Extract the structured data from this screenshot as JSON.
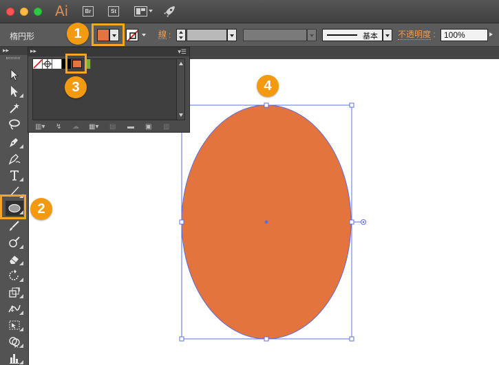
{
  "app": {
    "logo": "Ai",
    "bridge_label": "Br",
    "stock_label": "St",
    "icons": [
      "close-light",
      "minimize-light",
      "maximize-light",
      "layout-icon",
      "rocket-icon"
    ]
  },
  "control_bar": {
    "tool_name": "楕円形",
    "fill_color": "#e4743e",
    "stroke_label": "線",
    "stroke_colon": ":",
    "brush_label": "基本",
    "opacity_label": "不透明度",
    "opacity_colon": ":",
    "opacity_value": "100%"
  },
  "swatches_panel": {
    "panel_arrows": "▸▸",
    "menu_glyph": "▾☰",
    "swatches": [
      "none",
      "registration",
      "white",
      "black",
      "orange",
      "green"
    ],
    "selected_swatch": "orange"
  },
  "toolbar": {
    "header_arrows": "▸▸",
    "active_tool": "ellipse-tool"
  },
  "callouts": {
    "one": "1",
    "two": "2",
    "three": "3",
    "four": "4"
  },
  "colors": {
    "accent_orange": "#f5a623",
    "badge_orange": "#f39a11",
    "ellipse_fill": "#e4743e",
    "selection_blue": "#4a64d6"
  }
}
